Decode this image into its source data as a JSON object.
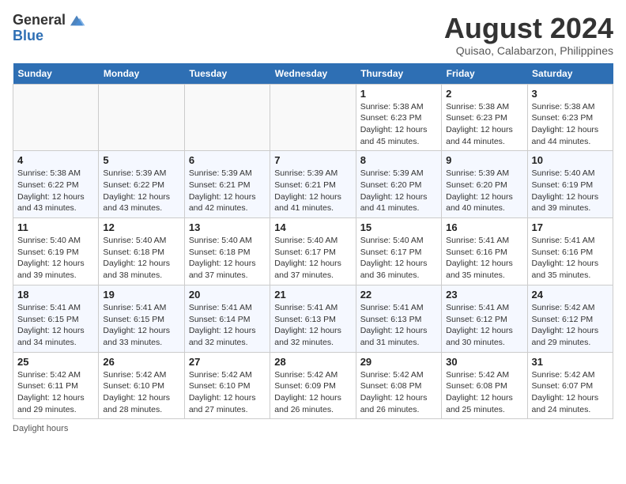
{
  "logo": {
    "line1": "General",
    "line2": "Blue"
  },
  "title": "August 2024",
  "subtitle": "Quisao, Calabarzon, Philippines",
  "days_of_week": [
    "Sunday",
    "Monday",
    "Tuesday",
    "Wednesday",
    "Thursday",
    "Friday",
    "Saturday"
  ],
  "footer": "Daylight hours",
  "weeks": [
    [
      {
        "day": "",
        "info": ""
      },
      {
        "day": "",
        "info": ""
      },
      {
        "day": "",
        "info": ""
      },
      {
        "day": "",
        "info": ""
      },
      {
        "day": "1",
        "info": "Sunrise: 5:38 AM\nSunset: 6:23 PM\nDaylight: 12 hours\nand 45 minutes."
      },
      {
        "day": "2",
        "info": "Sunrise: 5:38 AM\nSunset: 6:23 PM\nDaylight: 12 hours\nand 44 minutes."
      },
      {
        "day": "3",
        "info": "Sunrise: 5:38 AM\nSunset: 6:23 PM\nDaylight: 12 hours\nand 44 minutes."
      }
    ],
    [
      {
        "day": "4",
        "info": "Sunrise: 5:38 AM\nSunset: 6:22 PM\nDaylight: 12 hours\nand 43 minutes."
      },
      {
        "day": "5",
        "info": "Sunrise: 5:39 AM\nSunset: 6:22 PM\nDaylight: 12 hours\nand 43 minutes."
      },
      {
        "day": "6",
        "info": "Sunrise: 5:39 AM\nSunset: 6:21 PM\nDaylight: 12 hours\nand 42 minutes."
      },
      {
        "day": "7",
        "info": "Sunrise: 5:39 AM\nSunset: 6:21 PM\nDaylight: 12 hours\nand 41 minutes."
      },
      {
        "day": "8",
        "info": "Sunrise: 5:39 AM\nSunset: 6:20 PM\nDaylight: 12 hours\nand 41 minutes."
      },
      {
        "day": "9",
        "info": "Sunrise: 5:39 AM\nSunset: 6:20 PM\nDaylight: 12 hours\nand 40 minutes."
      },
      {
        "day": "10",
        "info": "Sunrise: 5:40 AM\nSunset: 6:19 PM\nDaylight: 12 hours\nand 39 minutes."
      }
    ],
    [
      {
        "day": "11",
        "info": "Sunrise: 5:40 AM\nSunset: 6:19 PM\nDaylight: 12 hours\nand 39 minutes."
      },
      {
        "day": "12",
        "info": "Sunrise: 5:40 AM\nSunset: 6:18 PM\nDaylight: 12 hours\nand 38 minutes."
      },
      {
        "day": "13",
        "info": "Sunrise: 5:40 AM\nSunset: 6:18 PM\nDaylight: 12 hours\nand 37 minutes."
      },
      {
        "day": "14",
        "info": "Sunrise: 5:40 AM\nSunset: 6:17 PM\nDaylight: 12 hours\nand 37 minutes."
      },
      {
        "day": "15",
        "info": "Sunrise: 5:40 AM\nSunset: 6:17 PM\nDaylight: 12 hours\nand 36 minutes."
      },
      {
        "day": "16",
        "info": "Sunrise: 5:41 AM\nSunset: 6:16 PM\nDaylight: 12 hours\nand 35 minutes."
      },
      {
        "day": "17",
        "info": "Sunrise: 5:41 AM\nSunset: 6:16 PM\nDaylight: 12 hours\nand 35 minutes."
      }
    ],
    [
      {
        "day": "18",
        "info": "Sunrise: 5:41 AM\nSunset: 6:15 PM\nDaylight: 12 hours\nand 34 minutes."
      },
      {
        "day": "19",
        "info": "Sunrise: 5:41 AM\nSunset: 6:15 PM\nDaylight: 12 hours\nand 33 minutes."
      },
      {
        "day": "20",
        "info": "Sunrise: 5:41 AM\nSunset: 6:14 PM\nDaylight: 12 hours\nand 32 minutes."
      },
      {
        "day": "21",
        "info": "Sunrise: 5:41 AM\nSunset: 6:13 PM\nDaylight: 12 hours\nand 32 minutes."
      },
      {
        "day": "22",
        "info": "Sunrise: 5:41 AM\nSunset: 6:13 PM\nDaylight: 12 hours\nand 31 minutes."
      },
      {
        "day": "23",
        "info": "Sunrise: 5:41 AM\nSunset: 6:12 PM\nDaylight: 12 hours\nand 30 minutes."
      },
      {
        "day": "24",
        "info": "Sunrise: 5:42 AM\nSunset: 6:12 PM\nDaylight: 12 hours\nand 29 minutes."
      }
    ],
    [
      {
        "day": "25",
        "info": "Sunrise: 5:42 AM\nSunset: 6:11 PM\nDaylight: 12 hours\nand 29 minutes."
      },
      {
        "day": "26",
        "info": "Sunrise: 5:42 AM\nSunset: 6:10 PM\nDaylight: 12 hours\nand 28 minutes."
      },
      {
        "day": "27",
        "info": "Sunrise: 5:42 AM\nSunset: 6:10 PM\nDaylight: 12 hours\nand 27 minutes."
      },
      {
        "day": "28",
        "info": "Sunrise: 5:42 AM\nSunset: 6:09 PM\nDaylight: 12 hours\nand 26 minutes."
      },
      {
        "day": "29",
        "info": "Sunrise: 5:42 AM\nSunset: 6:08 PM\nDaylight: 12 hours\nand 26 minutes."
      },
      {
        "day": "30",
        "info": "Sunrise: 5:42 AM\nSunset: 6:08 PM\nDaylight: 12 hours\nand 25 minutes."
      },
      {
        "day": "31",
        "info": "Sunrise: 5:42 AM\nSunset: 6:07 PM\nDaylight: 12 hours\nand 24 minutes."
      }
    ]
  ]
}
